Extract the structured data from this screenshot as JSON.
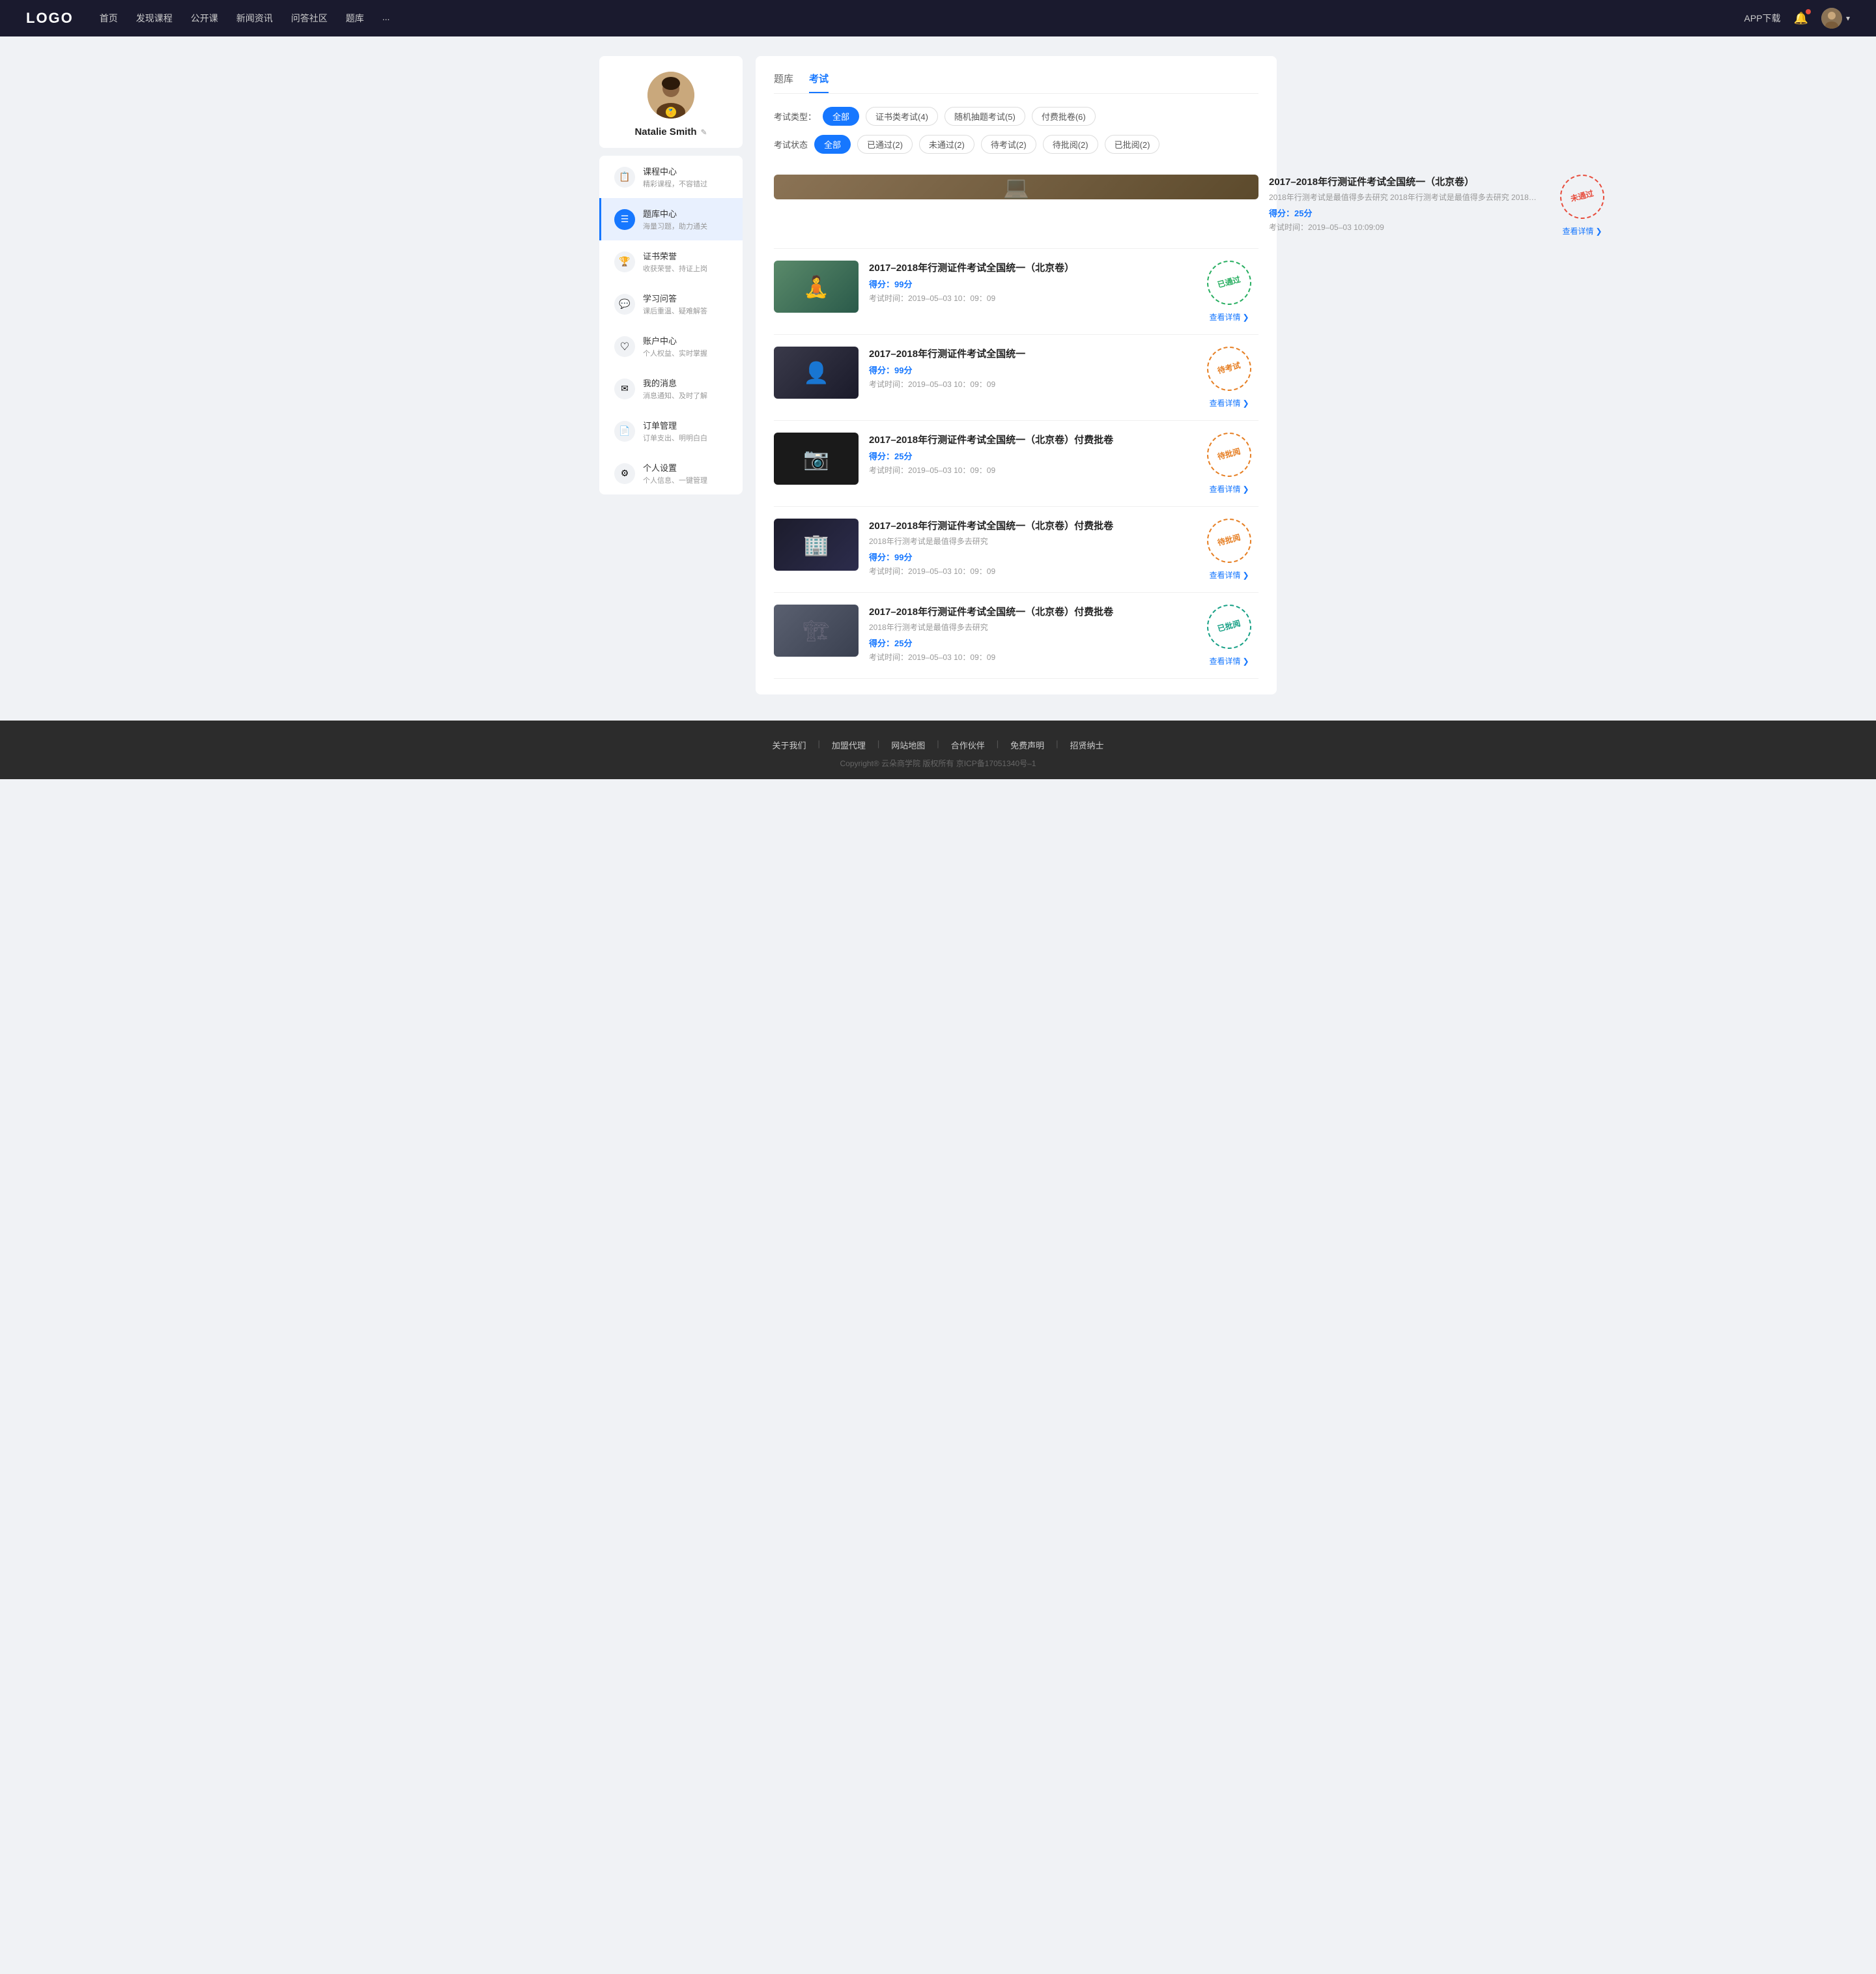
{
  "header": {
    "logo": "LOGO",
    "nav": [
      {
        "label": "首页",
        "href": "#"
      },
      {
        "label": "发现课程",
        "href": "#"
      },
      {
        "label": "公开课",
        "href": "#"
      },
      {
        "label": "新闻资讯",
        "href": "#"
      },
      {
        "label": "问答社区",
        "href": "#"
      },
      {
        "label": "题库",
        "href": "#"
      },
      {
        "label": "...",
        "href": "#"
      }
    ],
    "app_btn": "APP下载",
    "more_label": "..."
  },
  "sidebar": {
    "profile": {
      "name": "Natalie Smith",
      "edit_icon": "✎"
    },
    "nav_items": [
      {
        "id": "course-center",
        "icon": "📋",
        "title": "课程中心",
        "sub": "精彩课程，不容错过",
        "active": false
      },
      {
        "id": "question-bank",
        "icon": "☰",
        "title": "题库中心",
        "sub": "海量习题，助力通关",
        "active": true
      },
      {
        "id": "certificate",
        "icon": "🏆",
        "title": "证书荣誉",
        "sub": "收获荣誉、持证上岗",
        "active": false
      },
      {
        "id": "learning-qa",
        "icon": "💬",
        "title": "学习问答",
        "sub": "课后重温、疑难解答",
        "active": false
      },
      {
        "id": "account-center",
        "icon": "♡",
        "title": "账户中心",
        "sub": "个人权益、实时掌握",
        "active": false
      },
      {
        "id": "messages",
        "icon": "✉",
        "title": "我的消息",
        "sub": "消息通知、及时了解",
        "active": false
      },
      {
        "id": "orders",
        "icon": "📄",
        "title": "订单管理",
        "sub": "订单支出、明明白白",
        "active": false
      },
      {
        "id": "settings",
        "icon": "⚙",
        "title": "个人设置",
        "sub": "个人信息、一键管理",
        "active": false
      }
    ]
  },
  "content": {
    "top_tabs": [
      {
        "label": "题库",
        "active": false
      },
      {
        "label": "考试",
        "active": true
      }
    ],
    "filter_type": {
      "label": "考试类型：",
      "tags": [
        {
          "label": "全部",
          "active": true
        },
        {
          "label": "证书类考试(4)",
          "active": false
        },
        {
          "label": "随机抽题考试(5)",
          "active": false
        },
        {
          "label": "付费批卷(6)",
          "active": false
        }
      ]
    },
    "filter_status": {
      "label": "考试状态",
      "tags": [
        {
          "label": "全部",
          "active": true
        },
        {
          "label": "已通过(2)",
          "active": false
        },
        {
          "label": "未通过(2)",
          "active": false
        },
        {
          "label": "待考试(2)",
          "active": false
        },
        {
          "label": "待批阅(2)",
          "active": false
        },
        {
          "label": "已批阅(2)",
          "active": false
        }
      ]
    },
    "exam_items": [
      {
        "id": 1,
        "title": "2017–2018年行测证件考试全国统一（北京卷）",
        "desc": "2018年行测考试是最值得多去研究 2018年行测考试是最值得多去研究 2018年行...",
        "score_label": "得分：",
        "score_value": "25分",
        "time_label": "考试时间：",
        "time_value": "2019–05–03  10:09:09",
        "status": "未通过",
        "status_class": "stamp-red",
        "detail_label": "查看详情",
        "thumb_class": "thumb-laptop"
      },
      {
        "id": 2,
        "title": "2017–2018年行测证件考试全国统一（北京卷）",
        "desc": "",
        "score_label": "得分：",
        "score_value": "99分",
        "time_label": "考试时间：",
        "time_value": "2019–05–03  10：09：09",
        "status": "已通过",
        "status_class": "stamp-green",
        "detail_label": "查看详情",
        "thumb_class": "thumb-person"
      },
      {
        "id": 3,
        "title": "2017–2018年行测证件考试全国统一",
        "desc": "",
        "score_label": "得分：",
        "score_value": "99分",
        "time_label": "考试时间：",
        "time_value": "2019–05–03  10：09：09",
        "status": "待考试",
        "status_class": "stamp-orange",
        "detail_label": "查看详情",
        "thumb_class": "thumb-3"
      },
      {
        "id": 4,
        "title": "2017–2018年行测证件考试全国统一（北京卷）付费批卷",
        "desc": "",
        "score_label": "得分：",
        "score_value": "25分",
        "time_label": "考试时间：",
        "time_value": "2019–05–03  10：09：09",
        "status": "待批阅",
        "status_class": "stamp-orange",
        "detail_label": "查看详情",
        "thumb_class": "thumb-cam"
      },
      {
        "id": 5,
        "title": "2017–2018年行测证件考试全国统一（北京卷）付费批卷",
        "desc": "2018年行测考试是最值得多去研究",
        "score_label": "得分：",
        "score_value": "99分",
        "time_label": "考试时间：",
        "time_value": "2019–05–03  10：09：09",
        "status": "待批阅",
        "status_class": "stamp-orange",
        "detail_label": "查看详情",
        "thumb_class": "thumb-building"
      },
      {
        "id": 6,
        "title": "2017–2018年行测证件考试全国统一（北京卷）付费批卷",
        "desc": "2018年行测考试是最值得多去研究",
        "score_label": "得分：",
        "score_value": "25分",
        "time_label": "考试时间：",
        "time_value": "2019–05–03  10：09：09",
        "status": "已批阅",
        "status_class": "stamp-teal",
        "detail_label": "查看详情",
        "thumb_class": "thumb-building2"
      }
    ]
  },
  "footer": {
    "links": [
      {
        "label": "关于我们"
      },
      {
        "label": "加盟代理"
      },
      {
        "label": "网站地图"
      },
      {
        "label": "合作伙伴"
      },
      {
        "label": "免费声明"
      },
      {
        "label": "招贤纳士"
      }
    ],
    "copyright": "Copyright® 云朵商学院  版权所有    京ICP备17051340号–1"
  }
}
